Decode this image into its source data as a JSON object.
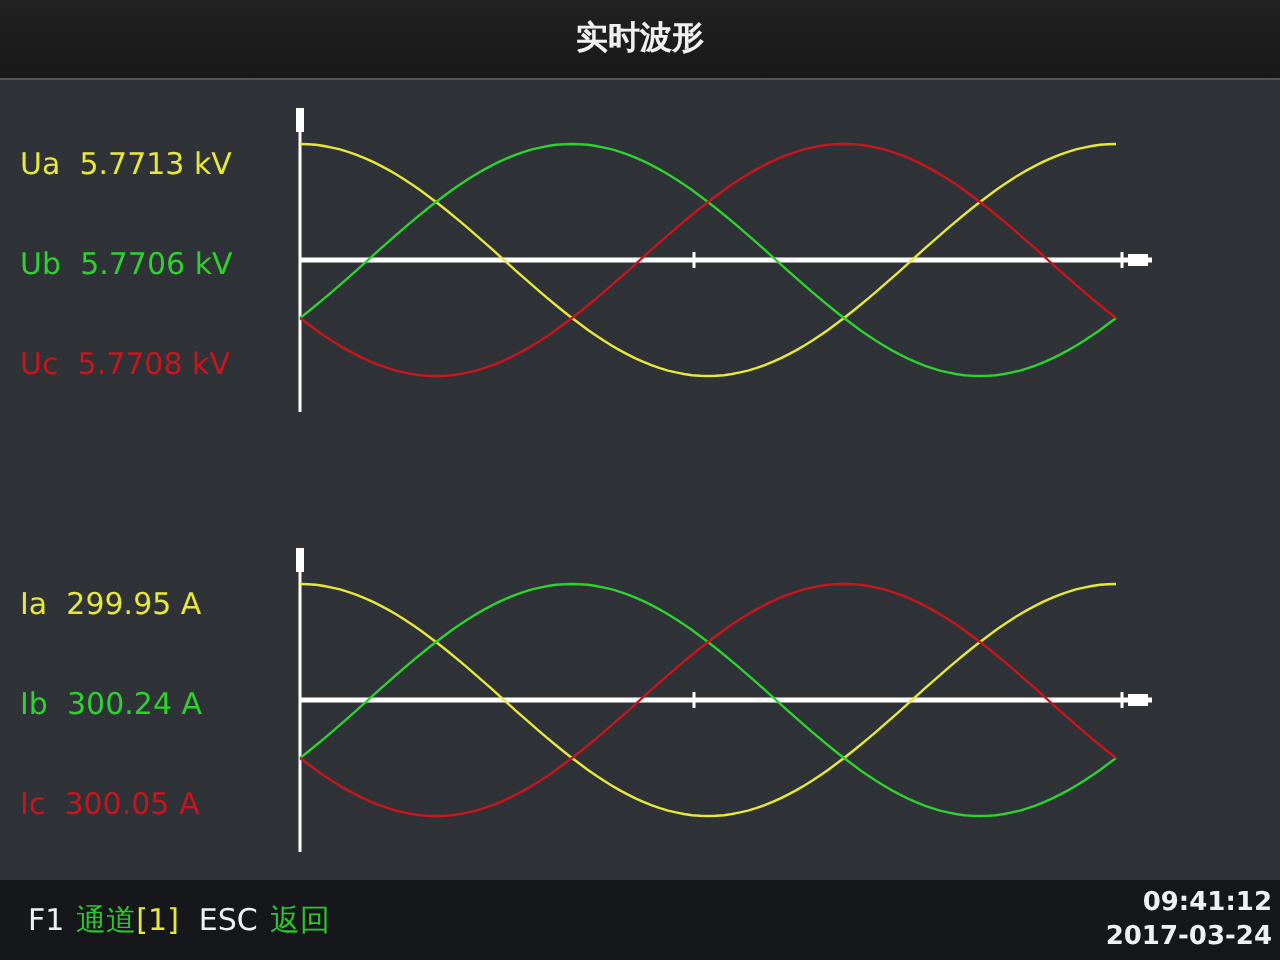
{
  "window": {
    "title": "实时波形"
  },
  "panels": [
    {
      "channels": [
        {
          "name": "Ua",
          "reading": "5.7713 kV",
          "color": "#e8e83a"
        },
        {
          "name": "Ub",
          "reading": "5.7706 kV",
          "color": "#2ed12e"
        },
        {
          "name": "Uc",
          "reading": "5.7708 kV",
          "color": "#c8161e"
        }
      ]
    },
    {
      "channels": [
        {
          "name": "Ia",
          "reading": "299.95 A",
          "color": "#e8e83a"
        },
        {
          "name": "Ib",
          "reading": "300.24 A",
          "color": "#2ed12e"
        },
        {
          "name": "Ic",
          "reading": "300.05 A",
          "color": "#c8161e"
        }
      ]
    }
  ],
  "status_bar": {
    "keys": [
      {
        "key": "F1",
        "label": "通道",
        "value": "[1]"
      },
      {
        "key": "ESC",
        "label": "返回"
      }
    ],
    "time": "09:41:12",
    "date": "2017-03-24"
  }
}
